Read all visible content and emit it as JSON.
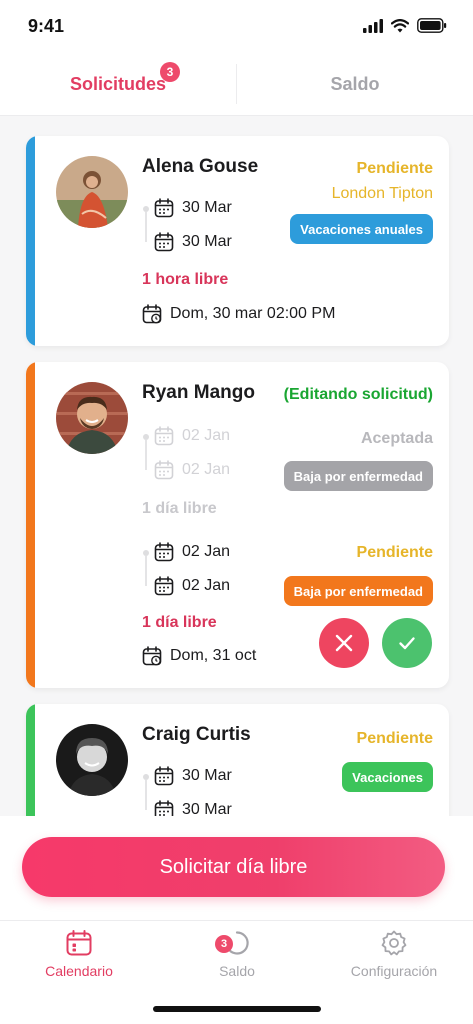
{
  "status_bar": {
    "time": "9:41"
  },
  "tabs": {
    "requests_label": "Solicitudes",
    "requests_badge": "3",
    "balance_label": "Saldo"
  },
  "cards": [
    {
      "name": "Alena Gouse",
      "start_date": "30 Mar",
      "end_date": "30 Mar",
      "status": "Pendiente",
      "approver": "London Tipton",
      "type": "Vacaciones anuales",
      "free_time": "1 hora libre",
      "detail": "Dom, 30 mar 02:00 PM",
      "accent": "#2d9cdb"
    },
    {
      "name": "Ryan Mango",
      "editing": "(Editando solicitud)",
      "old_start": "02 Jan",
      "old_end": "02 Jan",
      "old_status": "Aceptada",
      "old_type": "Baja por enfermedad",
      "old_free_time": "1 día libre",
      "new_start": "02 Jan",
      "new_end": "02 Jan",
      "new_status": "Pendiente",
      "new_type": "Baja por enfermedad",
      "new_free_time": "1 día libre",
      "detail": "Dom, 31 oct",
      "accent": "#f2771c"
    },
    {
      "name": "Craig Curtis",
      "start_date": "30 Mar",
      "end_date": "30 Mar",
      "status": "Pendiente",
      "type": "Vacaciones",
      "accent": "#3cc45a"
    }
  ],
  "cta": {
    "label": "Solicitar día libre"
  },
  "bottom_nav": {
    "calendar": "Calendario",
    "balance": "Saldo",
    "balance_badge": "3",
    "settings": "Configuración"
  },
  "colors": {
    "primary": "#e23d62",
    "pending": "#e6b52a",
    "editing": "#1aa632",
    "blue_pill": "#2d9cdb",
    "orange_pill": "#f2771c",
    "grey_pill": "#a4a4a8",
    "green_pill": "#3cc45a",
    "reject": "#ee4560",
    "approve": "#4cc26e"
  },
  "icons": [
    "signal-icon",
    "wifi-icon",
    "battery-icon",
    "calendar-icon",
    "calendar-clock-icon",
    "close-icon",
    "check-icon",
    "refresh-icon",
    "gear-icon"
  ]
}
